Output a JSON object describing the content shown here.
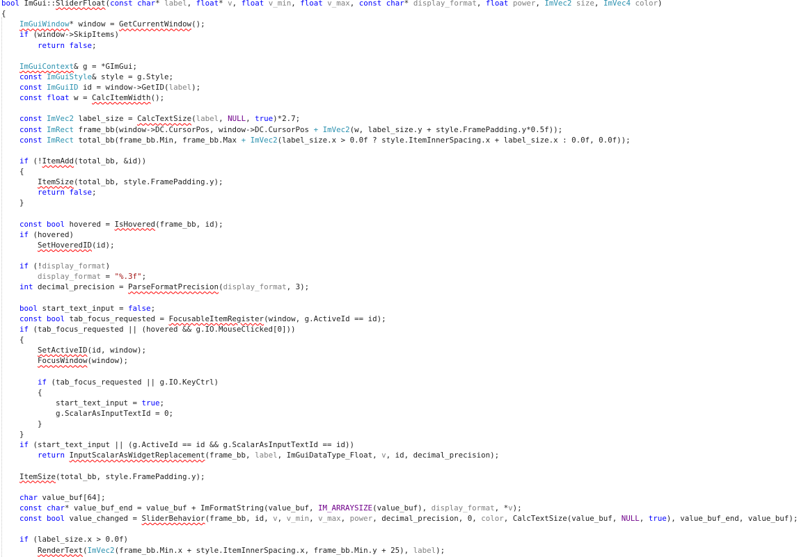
{
  "colors": {
    "keyword": "#0000ff",
    "type": "#2b91af",
    "parameter": "#808080",
    "string": "#a31515",
    "macro": "#6f008a",
    "plain": "#1e1e1e",
    "error_squiggle": "#ff0000",
    "background": "#ffffff"
  },
  "lines": [
    [
      [
        "kw",
        "bool "
      ],
      [
        "p",
        "ImGui::"
      ],
      [
        "pe",
        "SliderFloat"
      ],
      [
        "p",
        "("
      ],
      [
        "kw",
        "const char"
      ],
      [
        "p",
        "* "
      ],
      [
        "par",
        "label"
      ],
      [
        "p",
        ", "
      ],
      [
        "kw",
        "float"
      ],
      [
        "p",
        "* "
      ],
      [
        "par",
        "v"
      ],
      [
        "p",
        ", "
      ],
      [
        "kw",
        "float "
      ],
      [
        "par",
        "v_min"
      ],
      [
        "p",
        ", "
      ],
      [
        "kw",
        "float "
      ],
      [
        "par",
        "v_max"
      ],
      [
        "p",
        ", "
      ],
      [
        "kw",
        "const char"
      ],
      [
        "p",
        "* "
      ],
      [
        "par",
        "display_format"
      ],
      [
        "p",
        ", "
      ],
      [
        "kw",
        "float "
      ],
      [
        "par",
        "power"
      ],
      [
        "p",
        ", "
      ],
      [
        "ty",
        "ImVec2 "
      ],
      [
        "par",
        "size"
      ],
      [
        "p",
        ", "
      ],
      [
        "ty",
        "ImVec4 "
      ],
      [
        "par",
        "color"
      ],
      [
        "p",
        ")"
      ]
    ],
    [
      [
        "p",
        "{"
      ]
    ],
    [
      [
        "p",
        "    "
      ],
      [
        "tye",
        "ImGuiWindow"
      ],
      [
        "p",
        "* window = "
      ],
      [
        "pe",
        "GetCurrentWindow"
      ],
      [
        "p",
        "();"
      ]
    ],
    [
      [
        "p",
        "    "
      ],
      [
        "kw",
        "if "
      ],
      [
        "p",
        "(window->SkipItems)"
      ]
    ],
    [
      [
        "p",
        "        "
      ],
      [
        "kw",
        "return false"
      ],
      [
        "p",
        ";"
      ]
    ],
    [],
    [
      [
        "p",
        "    "
      ],
      [
        "tye",
        "ImGuiContext"
      ],
      [
        "p",
        "& g = *GImGui;"
      ]
    ],
    [
      [
        "p",
        "    "
      ],
      [
        "kw",
        "const "
      ],
      [
        "ty",
        "ImGuiStyle"
      ],
      [
        "p",
        "& style = g.Style;"
      ]
    ],
    [
      [
        "p",
        "    "
      ],
      [
        "kw",
        "const "
      ],
      [
        "ty",
        "ImGuiID "
      ],
      [
        "p",
        "id = window->GetID("
      ],
      [
        "par",
        "label"
      ],
      [
        "p",
        ");"
      ]
    ],
    [
      [
        "p",
        "    "
      ],
      [
        "kw",
        "const float "
      ],
      [
        "p",
        "w = "
      ],
      [
        "pe",
        "CalcItemWidth"
      ],
      [
        "p",
        "();"
      ]
    ],
    [],
    [
      [
        "p",
        "    "
      ],
      [
        "kw",
        "const "
      ],
      [
        "ty",
        "ImVec2 "
      ],
      [
        "p",
        "label_size = "
      ],
      [
        "pe",
        "CalcTextSize"
      ],
      [
        "p",
        "("
      ],
      [
        "par",
        "label"
      ],
      [
        "p",
        ", "
      ],
      [
        "mac",
        "NULL"
      ],
      [
        "p",
        ", "
      ],
      [
        "kw",
        "true"
      ],
      [
        "p",
        ")*2.7;"
      ]
    ],
    [
      [
        "p",
        "    "
      ],
      [
        "kw",
        "const "
      ],
      [
        "ty",
        "ImRect "
      ],
      [
        "p",
        "frame_bb(window->DC.CursorPos, window->DC.CursorPos "
      ],
      [
        "ty",
        "+ ImVec2"
      ],
      [
        "p",
        "(w, label_size.y + style.FramePadding.y*0.5f));"
      ]
    ],
    [
      [
        "p",
        "    "
      ],
      [
        "kw",
        "const "
      ],
      [
        "ty",
        "ImRect "
      ],
      [
        "p",
        "total_bb(frame_bb.Min, frame_bb.Max "
      ],
      [
        "ty",
        "+ ImVec2"
      ],
      [
        "p",
        "(label_size.x > 0.0f ? style.ItemInnerSpacing.x + label_size.x : 0.0f, 0.0f));"
      ]
    ],
    [],
    [
      [
        "p",
        "    "
      ],
      [
        "kw",
        "if "
      ],
      [
        "p",
        "(!"
      ],
      [
        "pe",
        "ItemAdd"
      ],
      [
        "p",
        "(total_bb, &id))"
      ]
    ],
    [
      [
        "p",
        "    {"
      ]
    ],
    [
      [
        "p",
        "        "
      ],
      [
        "pe",
        "ItemSize"
      ],
      [
        "p",
        "(total_bb, style.FramePadding.y);"
      ]
    ],
    [
      [
        "p",
        "        "
      ],
      [
        "kw",
        "return false"
      ],
      [
        "p",
        ";"
      ]
    ],
    [
      [
        "p",
        "    }"
      ]
    ],
    [],
    [
      [
        "p",
        "    "
      ],
      [
        "kw",
        "const bool "
      ],
      [
        "p",
        "hovered = "
      ],
      [
        "pe",
        "IsHovered"
      ],
      [
        "p",
        "(frame_bb, id);"
      ]
    ],
    [
      [
        "p",
        "    "
      ],
      [
        "kw",
        "if "
      ],
      [
        "p",
        "(hovered)"
      ]
    ],
    [
      [
        "p",
        "        "
      ],
      [
        "pe",
        "SetHoveredID"
      ],
      [
        "p",
        "(id);"
      ]
    ],
    [],
    [
      [
        "p",
        "    "
      ],
      [
        "kw",
        "if "
      ],
      [
        "p",
        "(!"
      ],
      [
        "par",
        "display_format"
      ],
      [
        "p",
        ")"
      ]
    ],
    [
      [
        "p",
        "        "
      ],
      [
        "par",
        "display_format "
      ],
      [
        "p",
        "= "
      ],
      [
        "str",
        "\"%.3f\""
      ],
      [
        "p",
        ";"
      ]
    ],
    [
      [
        "p",
        "    "
      ],
      [
        "kw",
        "int "
      ],
      [
        "p",
        "decimal_precision = "
      ],
      [
        "pe",
        "ParseFormatPrecision"
      ],
      [
        "p",
        "("
      ],
      [
        "par",
        "display_format"
      ],
      [
        "p",
        ", 3);"
      ]
    ],
    [],
    [
      [
        "p",
        "    "
      ],
      [
        "kw",
        "bool "
      ],
      [
        "p",
        "start_text_input = "
      ],
      [
        "kw",
        "false"
      ],
      [
        "p",
        ";"
      ]
    ],
    [
      [
        "p",
        "    "
      ],
      [
        "kw",
        "const bool "
      ],
      [
        "p",
        "tab_focus_requested = "
      ],
      [
        "pe",
        "FocusableItemRegister"
      ],
      [
        "p",
        "(window, g.ActiveId == id);"
      ]
    ],
    [
      [
        "p",
        "    "
      ],
      [
        "kw",
        "if "
      ],
      [
        "p",
        "(tab_focus_requested || (hovered && g.IO.MouseClicked[0]))"
      ]
    ],
    [
      [
        "p",
        "    {"
      ]
    ],
    [
      [
        "p",
        "        "
      ],
      [
        "pe",
        "SetActiveID"
      ],
      [
        "p",
        "(id, window);"
      ]
    ],
    [
      [
        "p",
        "        "
      ],
      [
        "pe",
        "FocusWindow"
      ],
      [
        "p",
        "(window);"
      ]
    ],
    [],
    [
      [
        "p",
        "        "
      ],
      [
        "kw",
        "if "
      ],
      [
        "p",
        "(tab_focus_requested || g.IO.KeyCtrl)"
      ]
    ],
    [
      [
        "p",
        "        {"
      ]
    ],
    [
      [
        "p",
        "            start_text_input = "
      ],
      [
        "kw",
        "true"
      ],
      [
        "p",
        ";"
      ]
    ],
    [
      [
        "p",
        "            g.ScalarAsInputTextId = 0;"
      ]
    ],
    [
      [
        "p",
        "        }"
      ]
    ],
    [
      [
        "p",
        "    }"
      ]
    ],
    [
      [
        "p",
        "    "
      ],
      [
        "kw",
        "if "
      ],
      [
        "p",
        "(start_text_input || (g.ActiveId == id && g.ScalarAsInputTextId == id))"
      ]
    ],
    [
      [
        "p",
        "        "
      ],
      [
        "kw",
        "return "
      ],
      [
        "pe",
        "InputScalarAsWidgetReplacement"
      ],
      [
        "p",
        "(frame_bb, "
      ],
      [
        "par",
        "label"
      ],
      [
        "p",
        ", ImGuiDataType_Float, "
      ],
      [
        "par",
        "v"
      ],
      [
        "p",
        ", id, decimal_precision);"
      ]
    ],
    [],
    [
      [
        "p",
        "    "
      ],
      [
        "pe",
        "ItemSize"
      ],
      [
        "p",
        "(total_bb, style.FramePadding.y);"
      ]
    ],
    [],
    [
      [
        "p",
        "    "
      ],
      [
        "kw",
        "char "
      ],
      [
        "p",
        "value_buf[64];"
      ]
    ],
    [
      [
        "p",
        "    "
      ],
      [
        "kw",
        "const char"
      ],
      [
        "p",
        "* value_buf_end = value_buf + ImFormatString(value_buf, "
      ],
      [
        "mac",
        "IM_ARRAYSIZE"
      ],
      [
        "p",
        "(value_buf), "
      ],
      [
        "par",
        "display_format"
      ],
      [
        "p",
        ", *"
      ],
      [
        "par",
        "v"
      ],
      [
        "p",
        ");"
      ]
    ],
    [
      [
        "p",
        "    "
      ],
      [
        "kw",
        "const bool "
      ],
      [
        "p",
        "value_changed = "
      ],
      [
        "pe",
        "SliderBehavior"
      ],
      [
        "p",
        "(frame_bb, id, "
      ],
      [
        "par",
        "v"
      ],
      [
        "p",
        ", "
      ],
      [
        "par",
        "v_min"
      ],
      [
        "p",
        ", "
      ],
      [
        "par",
        "v_max"
      ],
      [
        "p",
        ", "
      ],
      [
        "par",
        "power"
      ],
      [
        "p",
        ", decimal_precision, 0, "
      ],
      [
        "par",
        "color"
      ],
      [
        "p",
        ", CalcTextSize(value_buf, "
      ],
      [
        "mac",
        "NULL"
      ],
      [
        "p",
        ", "
      ],
      [
        "kw",
        "true"
      ],
      [
        "p",
        "), value_buf_end, value_buf);"
      ]
    ],
    [],
    [
      [
        "p",
        "    "
      ],
      [
        "kw",
        "if "
      ],
      [
        "p",
        "(label_size.x > 0.0f)"
      ]
    ],
    [
      [
        "p",
        "        "
      ],
      [
        "pe",
        "RenderText"
      ],
      [
        "p",
        "("
      ],
      [
        "ty",
        "ImVec2"
      ],
      [
        "p",
        "(frame_bb.Min.x + style.ItemInnerSpacing.x, frame_bb.Min.y + 25), "
      ],
      [
        "par",
        "label"
      ],
      [
        "p",
        ");"
      ]
    ]
  ]
}
